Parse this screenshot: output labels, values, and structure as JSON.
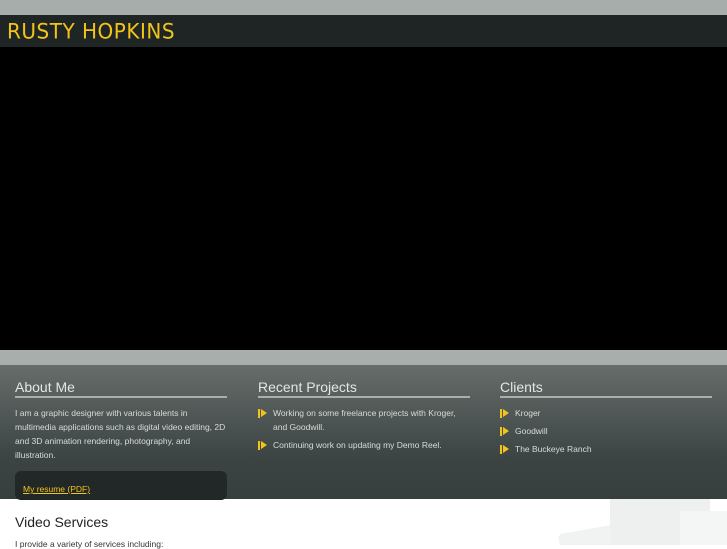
{
  "header": {
    "logo": "RUSTY HOPKINS"
  },
  "about": {
    "title": "About Me",
    "text": "I am a graphic designer with various talents in multimedia applications such as digital video editing, 2D and 3D animation rendering, photography, and illustration.",
    "resume_link": "My resume (PDF)"
  },
  "projects": {
    "title": "Recent Projects",
    "items": [
      "Working on some freelance projects with Kroger, and Goodwill.",
      "Continuing work on updating my Demo Reel."
    ]
  },
  "clients": {
    "title": "Clients",
    "items": [
      "Kroger",
      "Goodwill",
      "The Buckeye Ranch"
    ]
  },
  "services": {
    "title": "Video Services",
    "intro": "I provide a variety of services including:"
  },
  "colors": {
    "accent": "#f2c419",
    "header_bg": "#1f2525"
  }
}
